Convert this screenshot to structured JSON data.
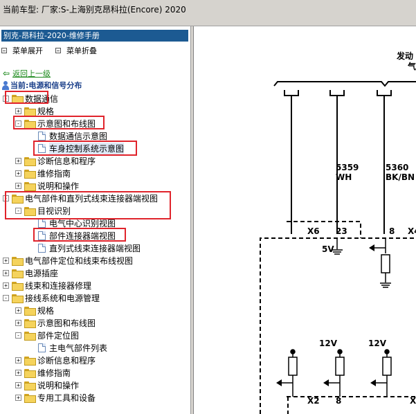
{
  "title_bar": {
    "text": "当前车型:  厂家:S-上海别克昂科拉(Encore) 2020"
  },
  "manual_title": "别克-昂科拉-2020-维修手册",
  "menu": {
    "expand_label": "菜单展开",
    "collapse_label": "菜单折叠"
  },
  "back_label": "返回上一级",
  "current_label": "当前:电源和信号分布",
  "tree": [
    {
      "label": "数据通信",
      "toggle": "-"
    },
    {
      "label": "规格",
      "toggle": "+"
    },
    {
      "label": "示意图和布线图",
      "toggle": "-"
    },
    {
      "label": "数据通信示意图"
    },
    {
      "label": "车身控制系统示意图"
    },
    {
      "label": "诊断信息和程序",
      "toggle": "+"
    },
    {
      "label": "维修指南",
      "toggle": "+"
    },
    {
      "label": "说明和操作",
      "toggle": "+"
    },
    {
      "label": "电气部件和直列式线束连接器端视图",
      "toggle": "-"
    },
    {
      "label": "目视识别",
      "toggle": "-"
    },
    {
      "label": "电气中心识别视图"
    },
    {
      "label": "部件连接器端视图"
    },
    {
      "label": "直列式线束连接器端视图"
    },
    {
      "label": "电气部件定位和线束布线视图",
      "toggle": "+"
    },
    {
      "label": "电源插座",
      "toggle": "+"
    },
    {
      "label": "线束和连接器修理",
      "toggle": "+"
    },
    {
      "label": "接线系统和电源管理",
      "toggle": "-"
    },
    {
      "label": "规格",
      "toggle": "+"
    },
    {
      "label": "示意图和布线图",
      "toggle": "+"
    },
    {
      "label": "部件定位图",
      "toggle": "-"
    },
    {
      "label": "主电气部件列表"
    },
    {
      "label": "诊断信息和程序",
      "toggle": "+"
    },
    {
      "label": "维修指南",
      "toggle": "+"
    },
    {
      "label": "说明和操作",
      "toggle": "+"
    },
    {
      "label": "专用工具和设备",
      "toggle": "+"
    }
  ],
  "diagram": {
    "header_top": "发动",
    "header_bottom": "气",
    "wire_a_num": "5359",
    "wire_a_color": "WH",
    "wire_b_num": "5360",
    "wire_b_color": "BK/BN",
    "conn_x6": "X6",
    "pin_23": "23",
    "pin_8": "8",
    "conn_x4": "X4",
    "label_5v": "5V",
    "label_12v_a": "12V",
    "label_12v_b": "12V",
    "conn_x2": "X2",
    "pin_bottom": "8",
    "conn_x_right": "X"
  }
}
